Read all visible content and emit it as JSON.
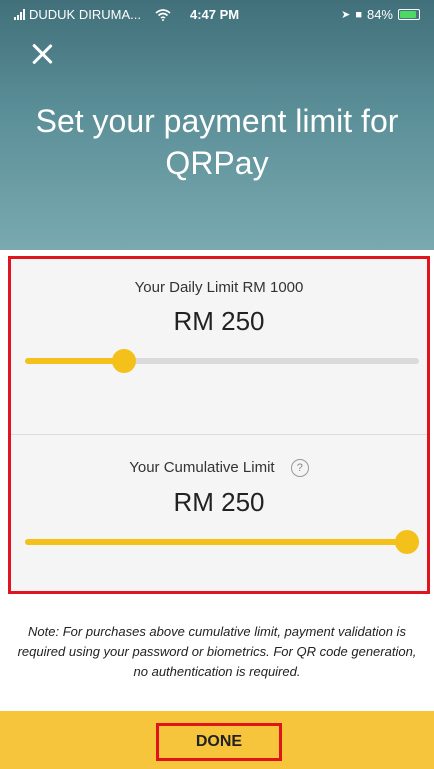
{
  "status_bar": {
    "carrier": "DUDUK DIRUMA...",
    "time": "4:47 PM",
    "battery": "84%"
  },
  "header": {
    "title": "Set your payment limit for QRPay"
  },
  "daily_limit": {
    "label": "Your Daily Limit RM 1000",
    "value": "RM 250",
    "slider_fraction": 0.25
  },
  "cumulative_limit": {
    "label": "Your Cumulative Limit",
    "value": "RM 250",
    "slider_fraction": 1.0
  },
  "note": "Note: For purchases above cumulative limit, payment validation is required using your password or biometrics. For QR code generation, no authentication is required.",
  "footer": {
    "done_label": "DONE"
  },
  "colors": {
    "header": "#5b8f98",
    "accent": "#f3c11a",
    "highlight": "#e0141e",
    "footer": "#f6c53c"
  }
}
